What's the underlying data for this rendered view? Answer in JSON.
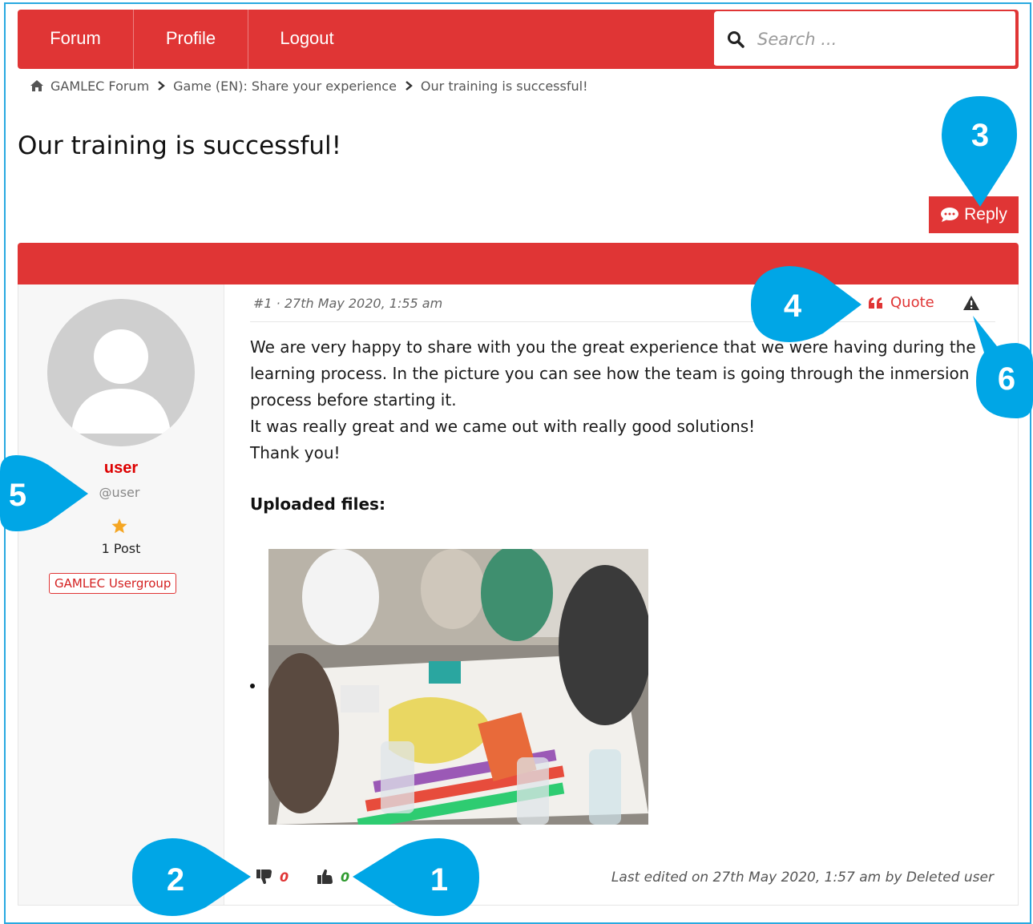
{
  "nav": {
    "items": [
      "Forum",
      "Profile",
      "Logout"
    ]
  },
  "search": {
    "placeholder": "Search ...",
    "icon": "search-icon"
  },
  "breadcrumb": {
    "items": [
      "GAMLEC Forum",
      "Game (EN): Share your experience",
      "Our training is successful!"
    ]
  },
  "topic": {
    "title": "Our training is successful!"
  },
  "reply_button": {
    "label": "Reply"
  },
  "post": {
    "author": {
      "name": "user",
      "handle": "@user",
      "post_count": "1 Post",
      "usergroup": "GAMLEC Usergroup"
    },
    "meta": "#1 · 27th May 2020, 1:55 am",
    "quote_label": "Quote",
    "body": [
      "We are very happy to share with you the great experience that we were having during the learning process.  In the picture you can see how the team is going through the inmersion process before starting it.",
      "It was really great and we came out with really good solutions!",
      "Thank you!"
    ],
    "uploaded_files_label": "Uploaded files:",
    "dislikes": "0",
    "likes": "0",
    "last_edited": "Last edited on 27th May 2020, 1:57 am by Deleted user"
  },
  "callouts": [
    "1",
    "2",
    "3",
    "4",
    "5",
    "6"
  ],
  "colors": {
    "accent": "#e03535",
    "callout": "#00a6e6",
    "frame": "#29a9e0"
  }
}
